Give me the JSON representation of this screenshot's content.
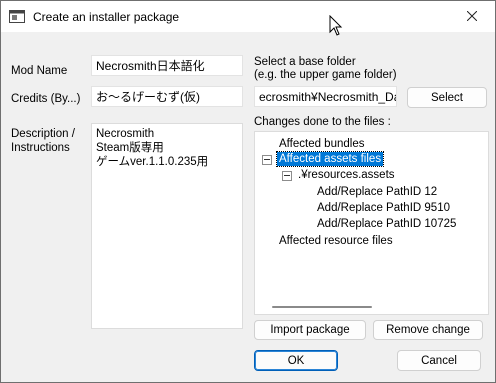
{
  "window": {
    "title": "Create an installer package",
    "close_glyph": "✕"
  },
  "form": {
    "mod_name_label": "Mod Name",
    "mod_name_value": "Necrosmith日本語化",
    "credits_label": "Credits (By...)",
    "credits_value": "お〜るげーむず(仮)",
    "description_label_line1": "Description /",
    "description_label_line2": "Instructions",
    "description_lines": [
      "Necrosmith",
      "Steam版専用",
      "ゲームver.1.1.0.235用"
    ]
  },
  "base_folder": {
    "label_line1": "Select a base folder",
    "label_line2": "(e.g. the upper game folder)",
    "value": "ecrosmith¥Necrosmith_Data",
    "select_button": "Select"
  },
  "changes": {
    "label": "Changes done to the files :",
    "tree": {
      "affected_bundles": "Affected bundles",
      "affected_assets": "Affected assets files",
      "resources_assets": ".¥resources.assets",
      "items": [
        "Add/Replace PathID 12",
        "Add/Replace PathID 9510",
        "Add/Replace PathID 10725"
      ],
      "affected_resources": "Affected resource files"
    }
  },
  "buttons": {
    "import_package": "Import package",
    "remove_change": "Remove change",
    "ok": "OK",
    "cancel": "Cancel"
  },
  "colors": {
    "selection": "#0078d7",
    "ok_border": "#005fb8"
  },
  "icons": {
    "app": "window-app-icon",
    "close": "close-icon",
    "cursor": "mouse-cursor-icon"
  }
}
